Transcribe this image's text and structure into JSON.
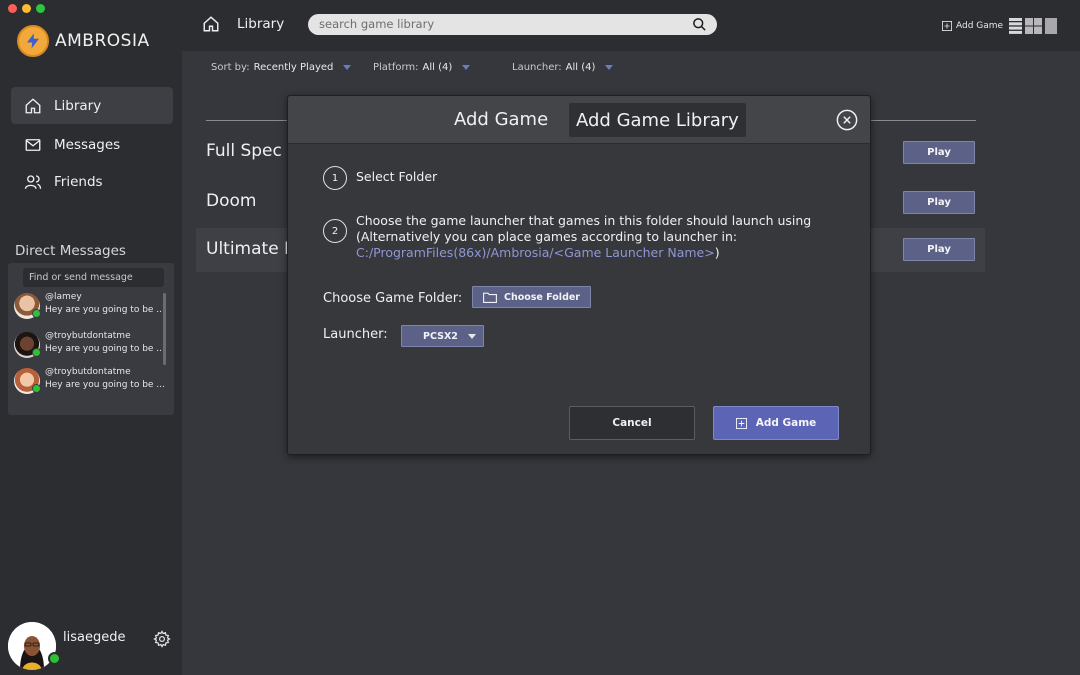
{
  "app": {
    "name": "AMBROSIA",
    "traffic_colors": [
      "#ff5f57",
      "#febc2e",
      "#28c840"
    ]
  },
  "sidebar": {
    "nav": [
      {
        "label": "Library",
        "icon": "home-icon",
        "active": true
      },
      {
        "label": "Messages",
        "icon": "mail-icon",
        "active": false
      },
      {
        "label": "Friends",
        "icon": "users-icon",
        "active": false
      }
    ],
    "direct_messages": {
      "title": "Direct Messages",
      "search_placeholder": "Find or send message",
      "entries": [
        {
          "name": "@lamey",
          "message": "Hey are you going to be ...",
          "online": true
        },
        {
          "name": "@troybutdontatme",
          "message": "Hey are you going to be ...",
          "online": true
        },
        {
          "name": "@troybutdontatme",
          "message": "Hey are you going to be ...",
          "online": true
        }
      ]
    },
    "user": {
      "name": "lisaegede",
      "online": true
    }
  },
  "topbar": {
    "breadcrumb": "Library",
    "search_placeholder": "search game library",
    "add_game_label": "Add Game"
  },
  "filters": {
    "sort": {
      "label": "Sort by:",
      "value": "Recently Played"
    },
    "platform": {
      "label": "Platform:",
      "value": "All (4)"
    },
    "launcher": {
      "label": "Launcher:",
      "value": "All (4)"
    }
  },
  "library": {
    "games": [
      {
        "name": "Full Spec",
        "play_label": "Play"
      },
      {
        "name": "Doom",
        "play_label": "Play"
      },
      {
        "name": "Ultimate I",
        "play_label": "Play"
      }
    ]
  },
  "modal": {
    "tab_add_game": "Add Game",
    "tab_add_library": "Add Game Library",
    "steps": [
      {
        "number": "1",
        "text": "Select Folder"
      },
      {
        "number": "2",
        "text": "Choose the game launcher that games in this folder should launch using",
        "text_line2": "(Alternatively you can place games according to launcher in:",
        "path": "C:/ProgramFiles(86x)/Ambrosia/<Game Launcher Name>",
        "path_suffix": ")"
      }
    ],
    "folder_label": "Choose Game Folder:",
    "folder_button": "Choose Folder",
    "launcher_label": "Launcher:",
    "launcher_value": "PCSX2",
    "cancel_label": "Cancel",
    "submit_label": "Add Game"
  },
  "colors": {
    "accent": "#5c65b5",
    "button": "#5b6187",
    "online": "#2fc135",
    "logo": "#f2a83a",
    "path_link": "#8e97d4"
  }
}
